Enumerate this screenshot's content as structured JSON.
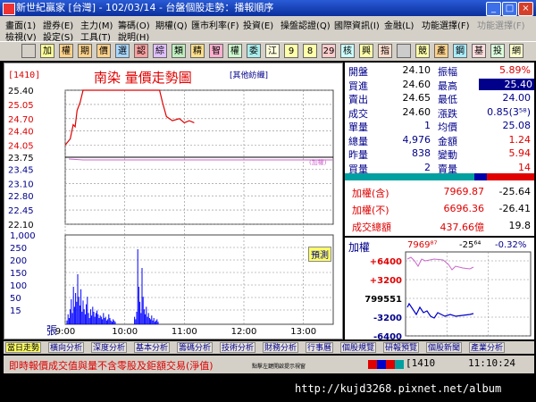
{
  "window": {
    "title": "新世紀贏家 [台灣] - 102/03/14 - 台盤個股走勢：播報順序"
  },
  "menu": {
    "row1": [
      "畫面(1)",
      "證券(E)",
      "主力(M)",
      "籌碼(O)",
      "期權(Q)",
      "匯市利率(F)",
      "投資(E)",
      "操盤認證(Q)",
      "國際資訊(I)",
      "金融(L)",
      "功能選擇(F)",
      "功能選擇(F)"
    ],
    "row2": [
      "檢視(V)",
      "設定(S)",
      "工具(T)",
      "說明(H)"
    ]
  },
  "toolbar": {
    "buttons": [
      "",
      "加",
      "權",
      "期",
      "價",
      "選",
      "認",
      "綜",
      "類",
      "精",
      "智",
      "權",
      "委",
      "江",
      "9",
      "8",
      "29",
      "核",
      "興",
      "指",
      "",
      "競",
      "產",
      "鋼",
      "基",
      "投",
      "網"
    ]
  },
  "chart": {
    "stock_id": "1410",
    "title": "南染 量價走勢圖",
    "subtitle": "[其他紡織]",
    "ref_label": "(加權)",
    "predict_label": "預測",
    "vol_unit": "張",
    "x_ticks": [
      "9:00",
      "10:00",
      "11:00",
      "12:00",
      "13:00"
    ],
    "price_ticks": [
      "25.40",
      "25.05",
      "24.70",
      "24.40",
      "24.05",
      "23.75",
      "23.45",
      "23.10",
      "22.80",
      "22.45",
      "22.10"
    ],
    "vol_ticks": [
      "1,000",
      "250",
      "200",
      "150",
      "100",
      "50",
      "15"
    ]
  },
  "chart_data": {
    "type": "line",
    "title": "南染 量價走勢圖",
    "ylim": [
      22.1,
      25.4
    ],
    "reference_price": 23.75,
    "price_series": [
      {
        "x": "9:00",
        "y": 24.05
      },
      {
        "x": "9:05",
        "y": 24.2
      },
      {
        "x": "9:08",
        "y": 24.55
      },
      {
        "x": "9:10",
        "y": 24.5
      },
      {
        "x": "9:12",
        "y": 24.9
      },
      {
        "x": "9:15",
        "y": 25.1
      },
      {
        "x": "9:18",
        "y": 25.4
      },
      {
        "x": "9:40",
        "y": 25.4
      },
      {
        "x": "10:00",
        "y": 25.4
      },
      {
        "x": "10:20",
        "y": 25.4
      },
      {
        "x": "10:35",
        "y": 25.4
      },
      {
        "x": "10:38",
        "y": 25.1
      },
      {
        "x": "10:42",
        "y": 24.75
      },
      {
        "x": "10:48",
        "y": 24.65
      },
      {
        "x": "10:55",
        "y": 24.7
      },
      {
        "x": "11:00",
        "y": 24.6
      },
      {
        "x": "11:05",
        "y": 24.65
      },
      {
        "x": "11:10",
        "y": 24.6
      }
    ],
    "volume_max": 1000
  },
  "quote": {
    "rows": [
      {
        "l1": "開盤",
        "v1": "24.10",
        "l2": "振幅",
        "v2": "5.89%",
        "c2": "#e00000"
      },
      {
        "l1": "買進",
        "v1": "24.60",
        "l2": "最高",
        "v2": "25.40",
        "c2": "#ffffff"
      },
      {
        "l1": "賣出",
        "v1": "24.65",
        "l2": "最低",
        "v2": "24.00",
        "c2": "#00008b"
      },
      {
        "l1": "成交",
        "v1": "24.60",
        "l2": "漲跌",
        "v2": "0.85(3⁵⁸)",
        "c2": "#00008b"
      },
      {
        "l1": "單量",
        "v1": "1",
        "l2": "均價",
        "v2": "25.08",
        "c2": "#00008b"
      },
      {
        "l1": "總量",
        "v1": "4,976",
        "l2": "金額",
        "v2": "1.24",
        "c2": "#e00000"
      },
      {
        "l1": "昨量",
        "v1": "838",
        "l2": "變動",
        "v2": "5.94",
        "c2": "#e00000"
      },
      {
        "l1": "買量",
        "v1": "2",
        "l2": "賣量",
        "v2": "14",
        "c2": "#e00000"
      }
    ]
  },
  "index": {
    "rows": [
      {
        "label": "加權(含)",
        "value": "7969.87",
        "change": "-25.64"
      },
      {
        "label": "加權(不)",
        "value": "6696.36",
        "change": "-26.41"
      },
      {
        "label": "成交總額",
        "value": "437.66億",
        "change": "19.8"
      }
    ]
  },
  "mini": {
    "label": "加權",
    "value": "7969⁸⁷",
    "change": "-25⁶⁴",
    "pct": "-0.32%",
    "ticks": [
      "+6400",
      "+3200",
      "799551",
      "-3200",
      "-6400"
    ]
  },
  "tabs": [
    "當日走勢",
    "橫向分析",
    "深度分析",
    "基本分析",
    "籌碼分析",
    "技術分析",
    "財務分析",
    "行事曆",
    "個股規覽",
    "研報預覽",
    "個股新聞",
    "產業分析"
  ],
  "status": {
    "message": "即時報價成交值與量不含零股及鉅額交易(淨值)",
    "small": "點擊左鍵開啟提示視窗",
    "code": "1410",
    "time": "11:10:24"
  },
  "url": "http://kujd3268.pixnet.net/album",
  "colors": {
    "up": "#e00000",
    "down": "#00008b",
    "price_line": "#e00000",
    "avg_line": "#cc66cc",
    "volume": "#0000ff"
  }
}
